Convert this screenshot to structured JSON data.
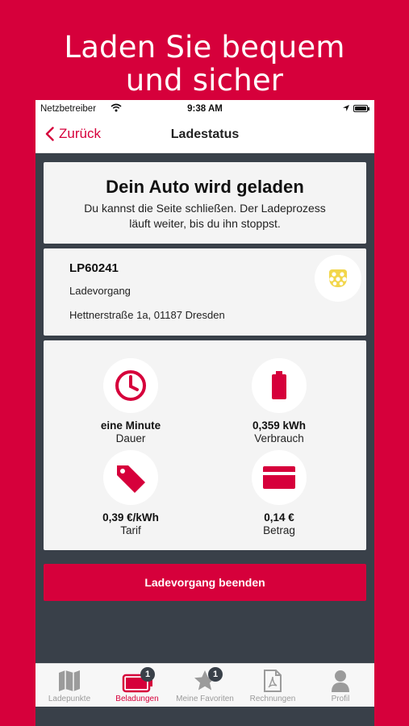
{
  "promo": {
    "line1": "Laden Sie bequem",
    "line2": "und sicher"
  },
  "status_bar": {
    "carrier": "Netzbetreiber",
    "time": "9:38 AM"
  },
  "nav": {
    "back_label": "Zurück",
    "title": "Ladestatus"
  },
  "charging_card": {
    "heading": "Dein Auto wird geladen",
    "line1": "Du kannst die Seite schließen. Der Ladeprozess",
    "line2": "läuft weiter, bis du ihn stoppst."
  },
  "station": {
    "code": "LP60241",
    "type": "Ladevorgang",
    "address": "Hettnerstraße 1a, 01187 Dresden",
    "icon": "plug-type2-icon"
  },
  "stats": [
    {
      "value": "eine Minute",
      "label": "Dauer",
      "icon": "clock-icon"
    },
    {
      "value": "0,359 kWh",
      "label": "Verbrauch",
      "icon": "battery-icon"
    },
    {
      "value": "0,39 €/kWh",
      "label": "Tarif",
      "icon": "price-tag-icon"
    },
    {
      "value": "0,14 €",
      "label": "Betrag",
      "icon": "credit-card-icon"
    }
  ],
  "end_button": "Ladevorgang beenden",
  "tabs": [
    {
      "label": "Ladepunkte",
      "icon": "map-icon"
    },
    {
      "label": "Beladungen",
      "icon": "battery-tab-icon",
      "badge": "1",
      "active": true
    },
    {
      "label": "Meine Favoriten",
      "icon": "star-icon",
      "badge": "1"
    },
    {
      "label": "Rechnungen",
      "icon": "pdf-document-icon"
    },
    {
      "label": "Profil",
      "icon": "person-icon"
    }
  ],
  "colors": {
    "brand": "#d6003b",
    "dark_background": "#394049",
    "card": "#f4f4f4",
    "plug_accent": "#f2d64b"
  }
}
